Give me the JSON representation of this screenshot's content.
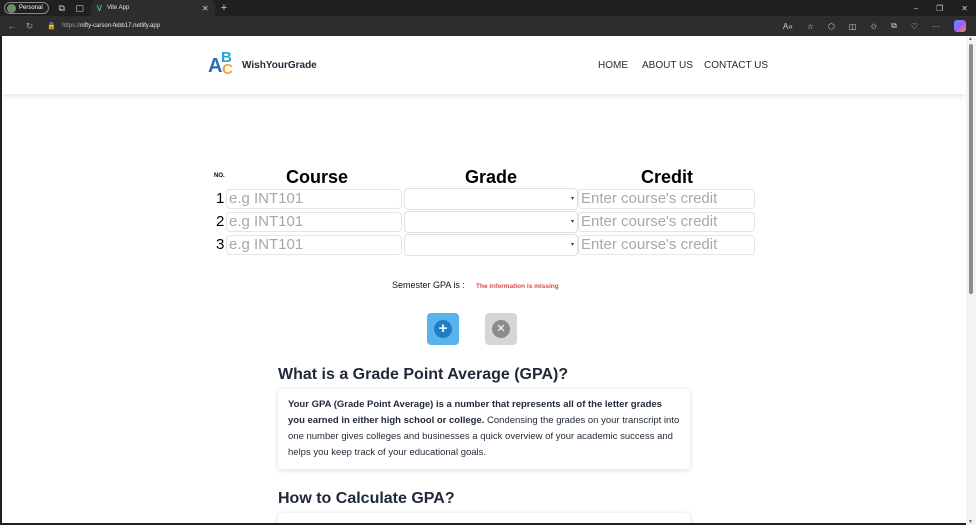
{
  "browser": {
    "profile_label": "Personal",
    "tab_title": "Vite App",
    "url_scheme": "https://",
    "url_host": "nifty-carson-febb17.netlify.app"
  },
  "header": {
    "logo": {
      "a": "A",
      "b": "B",
      "c": "C"
    },
    "brand": "WishYourGrade",
    "nav": [
      "HOME",
      "ABOUT US",
      "CONTACT US"
    ]
  },
  "table": {
    "no_header": "NO.",
    "course_header": "Course",
    "grade_header": "Grade",
    "credit_header": "Credit",
    "rows": [
      {
        "num": "1",
        "course_placeholder": "e.g INT101",
        "grade": "",
        "credit_placeholder": "Enter course's credit"
      },
      {
        "num": "2",
        "course_placeholder": "e.g INT101",
        "grade": "",
        "credit_placeholder": "Enter course's credit"
      },
      {
        "num": "3",
        "course_placeholder": "e.g INT101",
        "grade": "",
        "credit_placeholder": "Enter course's credit"
      }
    ]
  },
  "result": {
    "label": "Semester GPA is :",
    "error": "The information is missing",
    "error_color": "#e04848"
  },
  "buttons": {
    "add_icon": "plus-circle-icon",
    "clear_icon": "x-circle-icon",
    "add_color": "#5ab4ec",
    "clear_color": "#d6d6d6"
  },
  "sections": [
    {
      "title": "What is a Grade Point Average (GPA)?",
      "body_bold": "Your GPA (Grade Point Average) is a number that represents all of the letter grades you earned in either high school or college.",
      "body_rest": " Condensing the grades on your transcript into one number gives colleges and businesses a quick overview of your academic success and helps you keep track of your educational goals."
    },
    {
      "title": "How to Calculate GPA?"
    }
  ]
}
